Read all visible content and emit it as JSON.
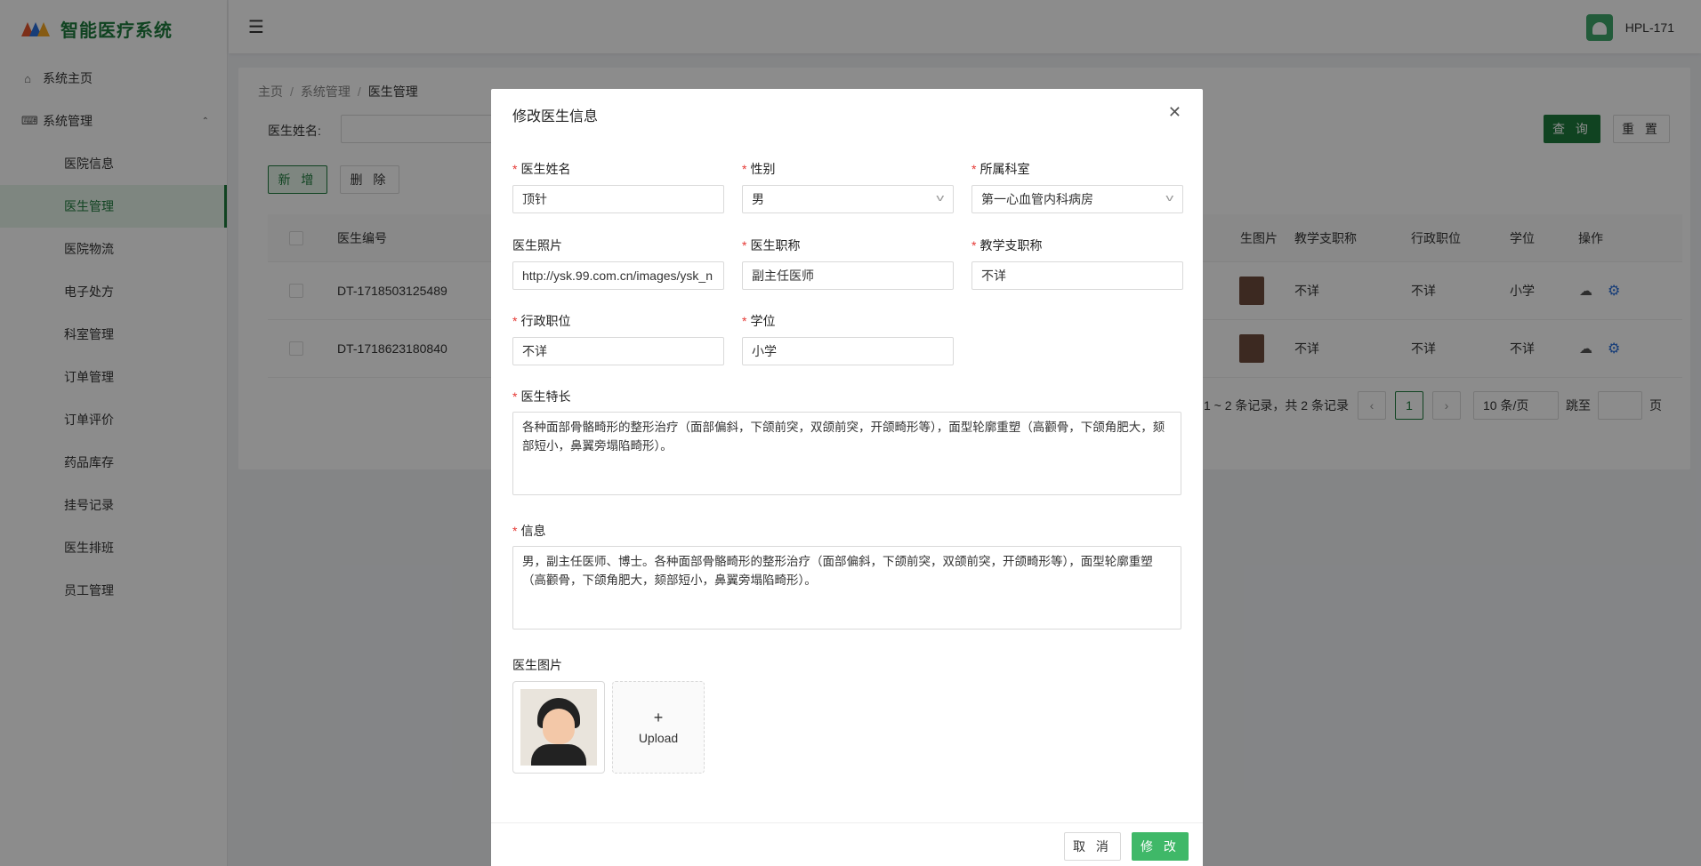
{
  "app": {
    "title": "智能医疗系统",
    "user": "HPL-171"
  },
  "colors": {
    "primary": "#1e7b3c",
    "submit": "#3fb868",
    "required": "#e53935"
  },
  "sidebar": {
    "home": "系统主页",
    "system": "系统管理",
    "items": [
      "医院信息",
      "医生管理",
      "医院物流",
      "电子处方",
      "科室管理",
      "订单管理",
      "订单评价",
      "药品库存",
      "挂号记录",
      "医生排班",
      "员工管理"
    ]
  },
  "breadcrumb": {
    "home": "主页",
    "system": "系统管理",
    "current": "医生管理"
  },
  "filter": {
    "label": "医生姓名:",
    "query": "查 询",
    "reset": "重 置"
  },
  "toolbar": {
    "add": "新 增",
    "delete": "删 除"
  },
  "table": {
    "headers": {
      "id": "医生编号",
      "photo": "生图片",
      "teach": "教学支职称",
      "admin": "行政职位",
      "degree": "学位",
      "ops": "操作"
    },
    "rows": [
      {
        "id": "DT-1718503125489",
        "teach": "不详",
        "admin": "不详",
        "degree": "小学"
      },
      {
        "id": "DT-1718623180840",
        "teach": "不详",
        "admin": "不详",
        "degree": "不详"
      }
    ]
  },
  "pager": {
    "summary": "1 ~ 2 条记录，共 2 条记录",
    "page": "1",
    "size": "10 条/页",
    "jump": "跳至",
    "unit": "页"
  },
  "modal": {
    "title": "修改医生信息",
    "name_label": "医生姓名",
    "name": "顶针",
    "gender_label": "性别",
    "gender": "男",
    "dept_label": "所属科室",
    "dept": "第一心血管内科病房",
    "photo_url_label": "医生照片",
    "photo_url": "http://ysk.99.com.cn/images/ysk_n",
    "title_label": "医生职称",
    "doctor_title": "副主任医师",
    "teach_label": "教学支职称",
    "teach": "不详",
    "admin_label": "行政职位",
    "admin": "不详",
    "degree_label": "学位",
    "degree": "小学",
    "specialty_label": "医生特长",
    "specialty": "各种面部骨骼畸形的整形治疗（面部偏斜，下颌前突，双颌前突，开颌畸形等），面型轮廓重塑（高颧骨，下颌角肥大，颏部短小，鼻翼旁塌陷畸形）。",
    "info_label": "信息",
    "info": "男，副主任医师、博士。各种面部骨骼畸形的整形治疗（面部偏斜，下颌前突，双颌前突，开颌畸形等），面型轮廓重塑（高颧骨，下颌角肥大，颏部短小，鼻翼旁塌陷畸形）。",
    "image_label": "医生图片",
    "upload": "Upload",
    "cancel": "取 消",
    "submit": "修 改"
  }
}
